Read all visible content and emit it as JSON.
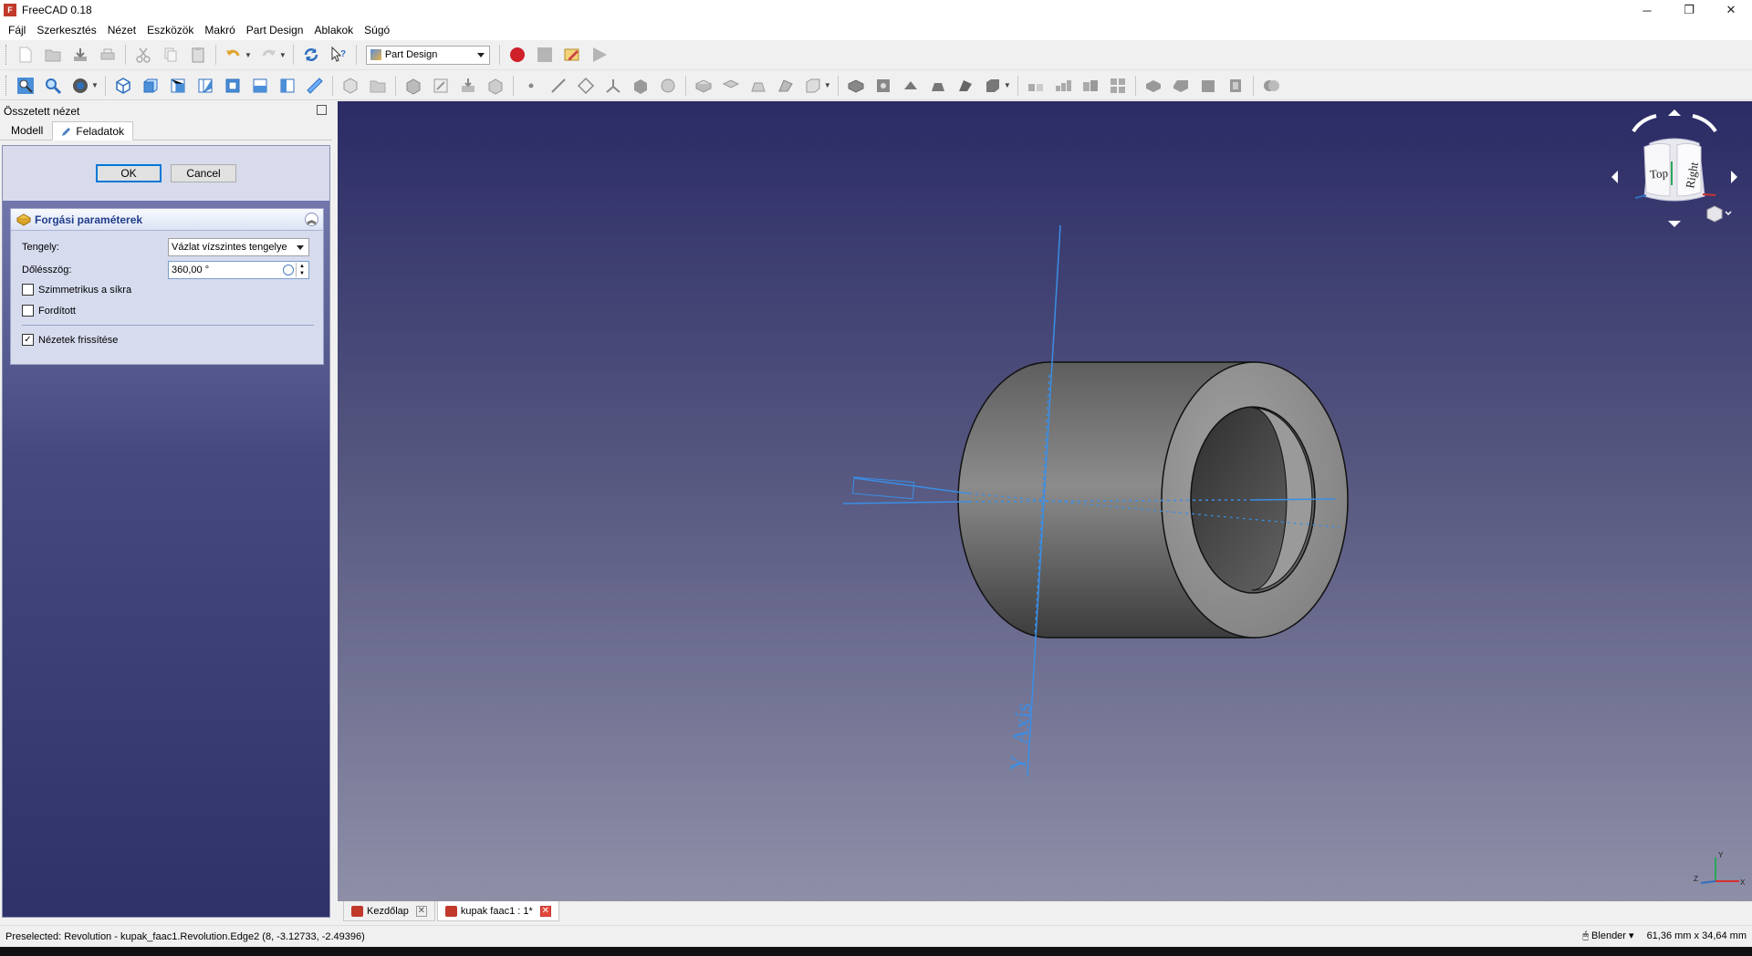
{
  "window": {
    "title": "FreeCAD 0.18",
    "controls": [
      "─",
      "❐",
      "✕"
    ]
  },
  "menu": [
    "Fájl",
    "Szerkesztés",
    "Nézet",
    "Eszközök",
    "Makró",
    "Part Design",
    "Ablakok",
    "Súgó"
  ],
  "toolbar": {
    "workbench": "Part Design"
  },
  "combo_view": {
    "title": "Összetett nézet",
    "tabs": {
      "model": "Modell",
      "tasks": "Feladatok"
    },
    "buttons": {
      "ok": "OK",
      "cancel": "Cancel"
    },
    "panel": {
      "title": "Forgási paraméterek",
      "axis_label": "Tengely:",
      "axis_value": "Vázlat vízszintes tengelye",
      "angle_label": "Dőlésszög:",
      "angle_value": "360,00 °",
      "symmetric_label": "Szimmetrikus a síkra",
      "symmetric_checked": false,
      "reversed_label": "Fordított",
      "reversed_checked": false,
      "update_label": "Nézetek frissítése",
      "update_checked": true
    }
  },
  "viewport": {
    "axis_label": "Y_Axis",
    "navcube": {
      "top": "Top",
      "right": "Right"
    },
    "mini_axes": {
      "x": "X",
      "y": "Y",
      "z": "Z"
    }
  },
  "doc_tabs": [
    {
      "label": "Kezdőlap",
      "active": false
    },
    {
      "label": "kupak faac1 : 1*",
      "active": true
    }
  ],
  "status": {
    "message": "Preselected: Revolution - kupak_faac1.Revolution.Edge2 (8, -3.12733, -2.49396)",
    "nav_style": "Blender",
    "dimensions": "61,36 mm x 34,64 mm"
  },
  "colors": {
    "accent": "#0078d7",
    "axis_line": "#3a8ee6",
    "record": "#d0202a"
  }
}
